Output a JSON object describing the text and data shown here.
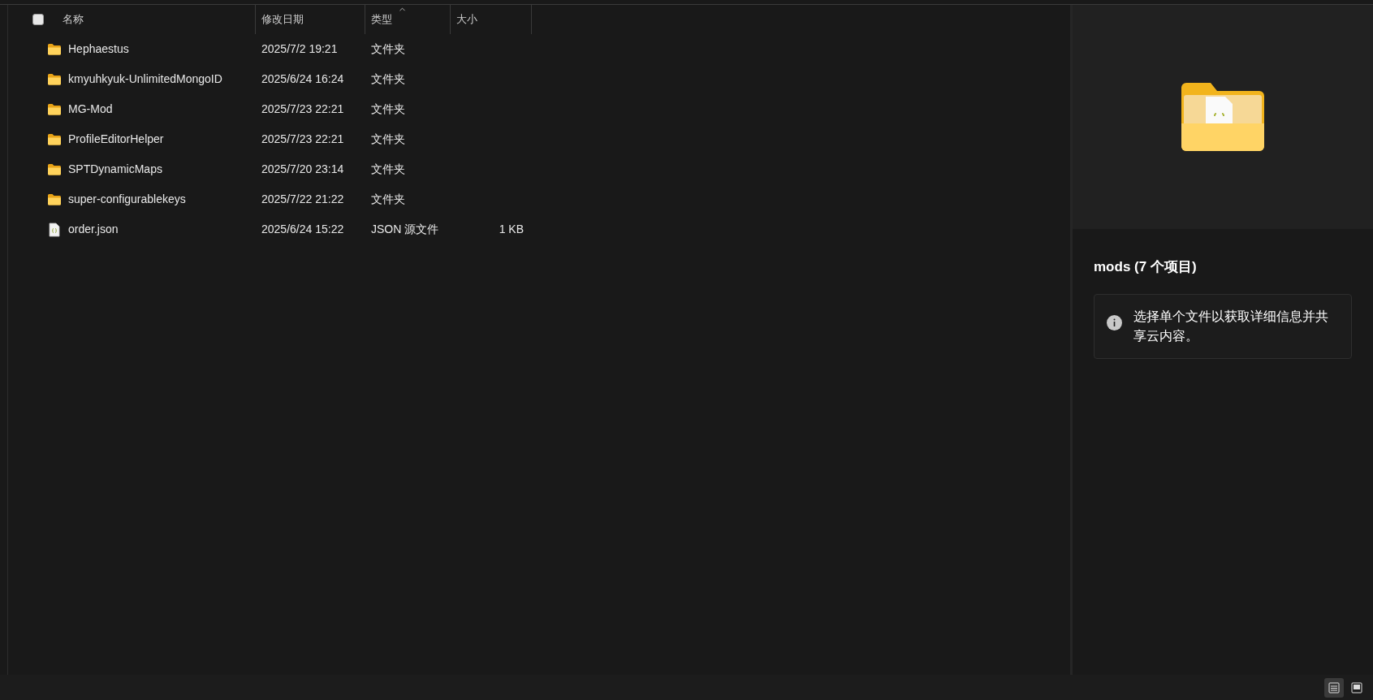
{
  "columns": [
    {
      "label": "名称",
      "sorted": false
    },
    {
      "label": "修改日期",
      "sorted": false
    },
    {
      "label": "类型",
      "sorted": true
    },
    {
      "label": "大小",
      "sorted": false
    }
  ],
  "select_all": {
    "checked": false
  },
  "rows": [
    {
      "kind": "folder",
      "name": "Hephaestus",
      "modified": "2025/7/2 19:21",
      "type": "文件夹"
    },
    {
      "kind": "folder",
      "name": "kmyuhkyuk-UnlimitedMongoID",
      "modified": "2025/6/24 16:24",
      "type": "文件夹"
    },
    {
      "kind": "folder",
      "name": "MG-Mod",
      "modified": "2025/7/23 22:21",
      "type": "文件夹"
    },
    {
      "kind": "folder",
      "name": "ProfileEditorHelper",
      "modified": "2025/7/23 22:21",
      "type": "文件夹"
    },
    {
      "kind": "folder",
      "name": "SPTDynamicMaps",
      "modified": "2025/7/20 23:14",
      "type": "文件夹"
    },
    {
      "kind": "folder",
      "name": "super-configurablekeys",
      "modified": "2025/7/22 21:22",
      "type": "文件夹"
    },
    {
      "kind": "json",
      "name": "order.json",
      "modified": "2025/6/24 15:22",
      "type": "JSON 源文件",
      "size": "1 KB"
    }
  ],
  "details_pane": {
    "title": "mods (7 个项目)",
    "info": "选择单个文件以获取详细信息并共享云内容。"
  },
  "view_buttons": [
    {
      "kind": "details",
      "selected": true
    },
    {
      "kind": "tiles",
      "selected": false
    }
  ]
}
